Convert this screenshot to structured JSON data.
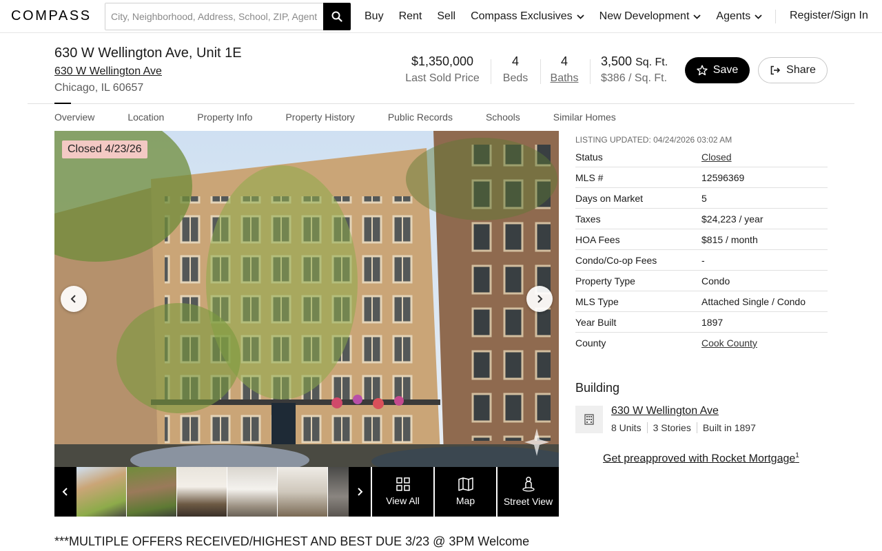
{
  "header": {
    "logo": "COMPASS",
    "search_placeholder": "City, Neighborhood, Address, School, ZIP, Agent",
    "nav": [
      {
        "label": "Buy",
        "has_dropdown": false
      },
      {
        "label": "Rent",
        "has_dropdown": false
      },
      {
        "label": "Sell",
        "has_dropdown": false
      },
      {
        "label": "Compass Exclusives",
        "has_dropdown": true
      },
      {
        "label": "New Development",
        "has_dropdown": true
      },
      {
        "label": "Agents",
        "has_dropdown": true
      }
    ],
    "signin": "Register/Sign In"
  },
  "listing": {
    "title": "630 W Wellington Ave, Unit 1E",
    "building_link": "630 W Wellington Ave",
    "city": "Chicago, IL 60657",
    "price": "$1,350,000",
    "price_label": "Last Sold Price",
    "beds": "4",
    "beds_label": "Beds",
    "baths": "4",
    "baths_label": "Baths",
    "sqft": "3,500",
    "sqft_unit": "Sq. Ft.",
    "price_per_sqft": "$386 / Sq. Ft.",
    "save_label": "Save",
    "share_label": "Share"
  },
  "tabs": [
    "Overview",
    "Location",
    "Property Info",
    "Property History",
    "Public Records",
    "Schools",
    "Similar Homes"
  ],
  "photo": {
    "badge": "Closed 4/23/26"
  },
  "strip": {
    "view_all": "View All",
    "map": "Map",
    "street_view": "Street View"
  },
  "details": {
    "updated": "LISTING UPDATED: 04/24/2026 03:02 AM",
    "rows": [
      {
        "label": "Status",
        "value": "Closed",
        "link": true
      },
      {
        "label": "MLS #",
        "value": "12596369",
        "link": false
      },
      {
        "label": "Days on Market",
        "value": "5",
        "link": false
      },
      {
        "label": "Taxes",
        "value": "$24,223 / year",
        "link": false
      },
      {
        "label": "HOA Fees",
        "value": "$815 / month",
        "link": false
      },
      {
        "label": "Condo/Co-op Fees",
        "value": "-",
        "link": false
      },
      {
        "label": "Property Type",
        "value": "Condo",
        "link": false
      },
      {
        "label": "MLS Type",
        "value": "Attached Single / Condo",
        "link": false
      },
      {
        "label": "Year Built",
        "value": "1897",
        "link": false
      },
      {
        "label": "County",
        "value": "Cook County",
        "link": true
      }
    ]
  },
  "building": {
    "heading": "Building",
    "name": "630 W Wellington Ave",
    "units": "8 Units",
    "stories": "3 Stories",
    "built": "Built in 1897",
    "preapproved": "Get preapproved with Rocket Mortgage",
    "footnote": "1"
  },
  "description": "***MULTIPLE OFFERS RECEIVED/HIGHEST AND BEST DUE 3/23 @ 3PM Welcome"
}
